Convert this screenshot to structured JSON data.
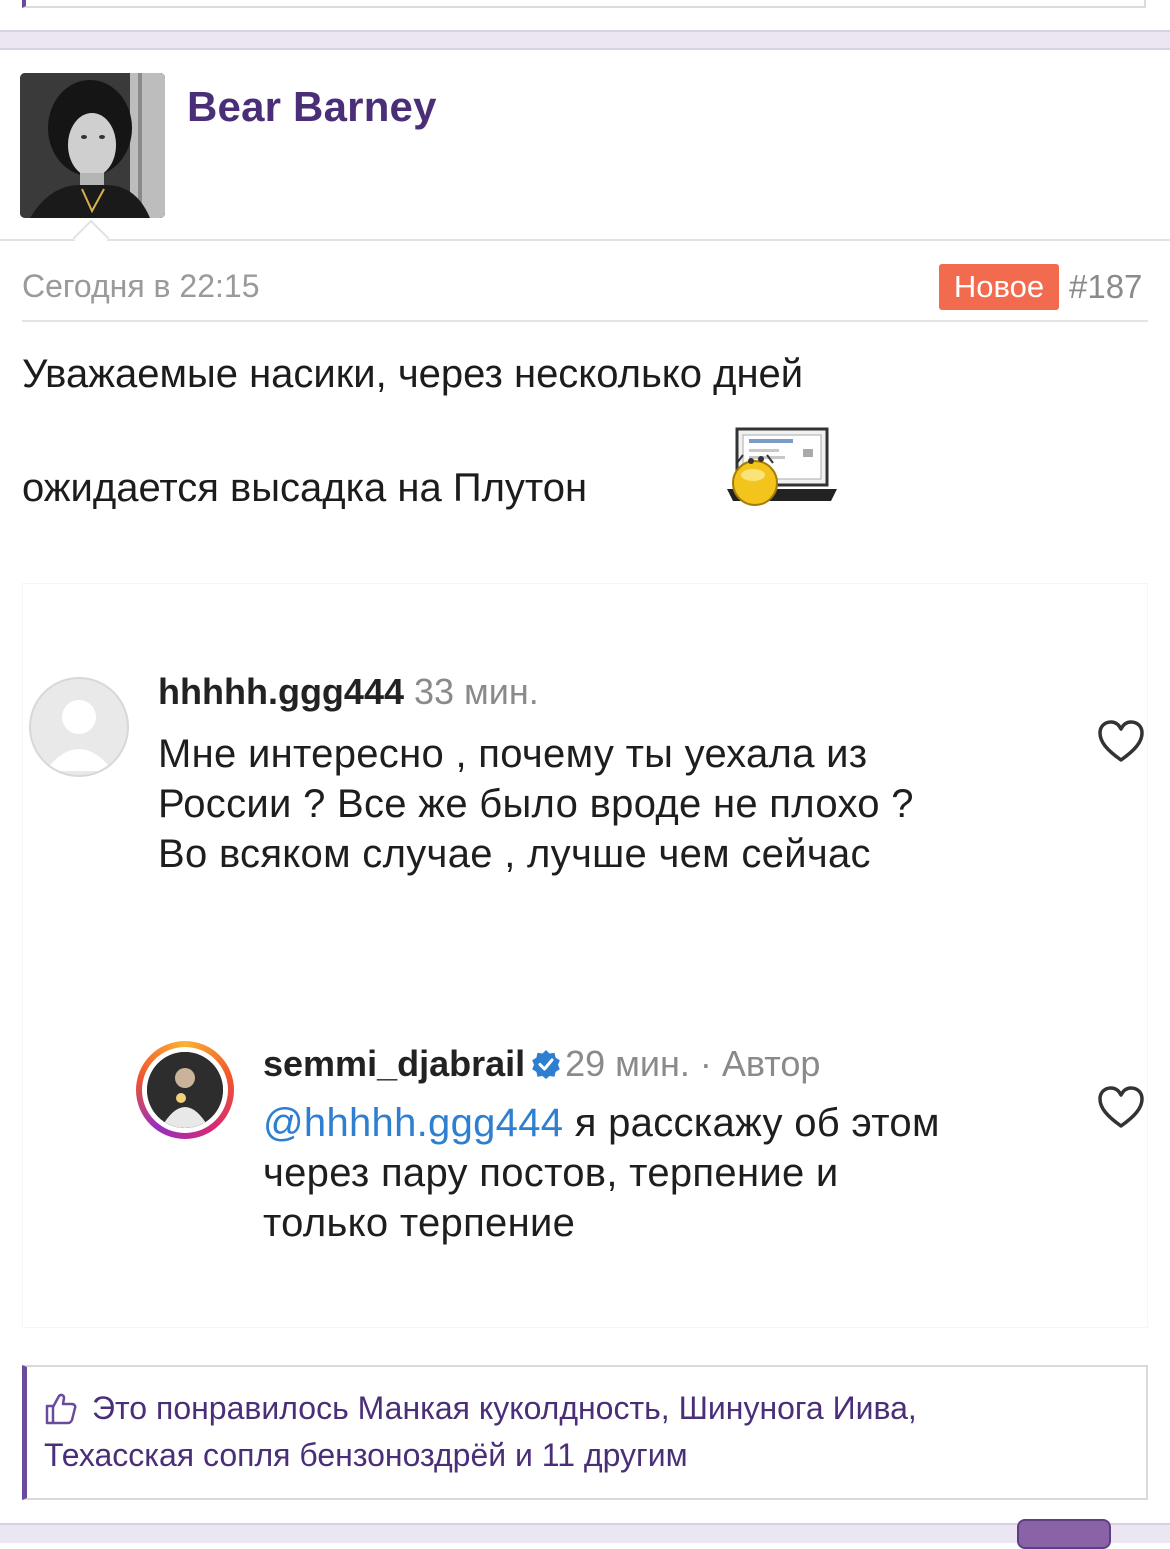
{
  "post": {
    "author": "Bear Barney",
    "date": "Сегодня в 22:15",
    "badge": "Новое",
    "number": "#187",
    "lines": [
      "Уважаемые насики, через несколько дней",
      "ожидается высадка на Плутон"
    ],
    "emoji_icon": "laptop-smiley-icon"
  },
  "screenshot": {
    "comment": {
      "user": "hhhhh.ggg444",
      "time": "33 мин.",
      "lines": [
        "Мне интересно , почему ты уехала из",
        "России ? Все же было вроде не плохо ?",
        "Во всяком случае , лучше чем сейчас"
      ],
      "like_icon": "heart-icon"
    },
    "reply": {
      "user": "semmi_djabrail",
      "meta": "29 мин. · Автор",
      "mention": "@hhhhh.ggg444",
      "lines": [
        " я расскажу об этом",
        "через пару постов, терпение и",
        "только терпение"
      ],
      "like_icon": "heart-icon",
      "verified_icon": "verified-badge-icon"
    }
  },
  "likes": {
    "icon": "thumbs-up-icon",
    "line1": "Это понравилось Манкая куколдность, Шинунога Иива,",
    "line2": "Техасская сопля бензоноздрёй и 11 другим"
  },
  "colors": {
    "accent": "#4a2f78",
    "badge": "#f26b4f",
    "mention": "#2f7fd0"
  }
}
